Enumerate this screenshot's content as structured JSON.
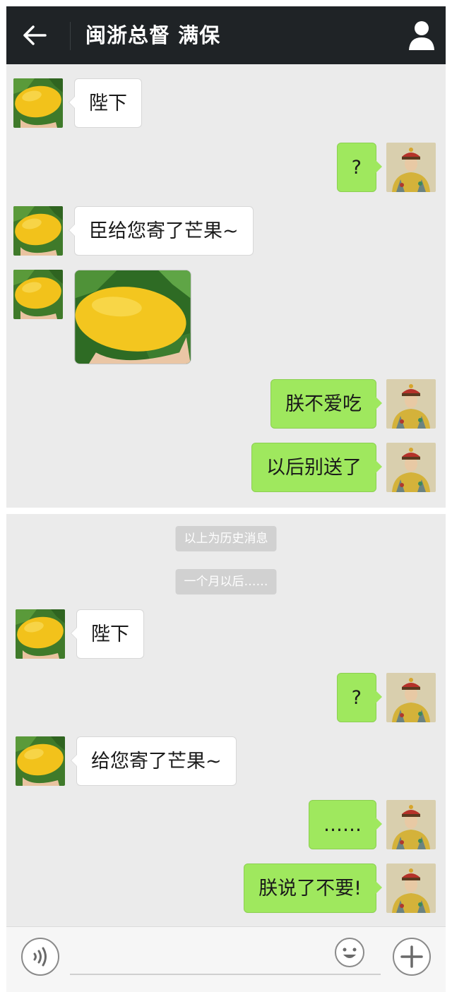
{
  "header": {
    "title": "闽浙总督 满保",
    "back_icon": "arrow-left-icon",
    "profile_icon": "person-icon"
  },
  "messages_top": [
    {
      "side": "left",
      "type": "text",
      "text": "陛下"
    },
    {
      "side": "right",
      "type": "text",
      "text": "?"
    },
    {
      "side": "left",
      "type": "text",
      "text": "臣给您寄了芒果~"
    },
    {
      "side": "left",
      "type": "image",
      "image": "mango-photo"
    },
    {
      "side": "right",
      "type": "text",
      "text": "朕不爱吃"
    },
    {
      "side": "right",
      "type": "text",
      "text": "以后别送了"
    }
  ],
  "system_notes": {
    "history": "以上为历史消息",
    "later": "一个月以后……"
  },
  "messages_bottom": [
    {
      "side": "left",
      "type": "text",
      "text": "陛下"
    },
    {
      "side": "right",
      "type": "text",
      "text": "?"
    },
    {
      "side": "left",
      "type": "text",
      "text": "给您寄了芒果~"
    },
    {
      "side": "right",
      "type": "text",
      "text": "……"
    },
    {
      "side": "right",
      "type": "text",
      "text": "朕说了不要!"
    }
  ],
  "input_bar": {
    "voice_icon": "voice-icon",
    "emoji_icon": "emoji-icon",
    "plus_icon": "plus-icon"
  },
  "colors": {
    "header_bg": "#1f2326",
    "chat_bg": "#ebebeb",
    "bubble_green": "#9fe85e",
    "bubble_white": "#ffffff",
    "system_note_bg": "#d1d1d1"
  }
}
